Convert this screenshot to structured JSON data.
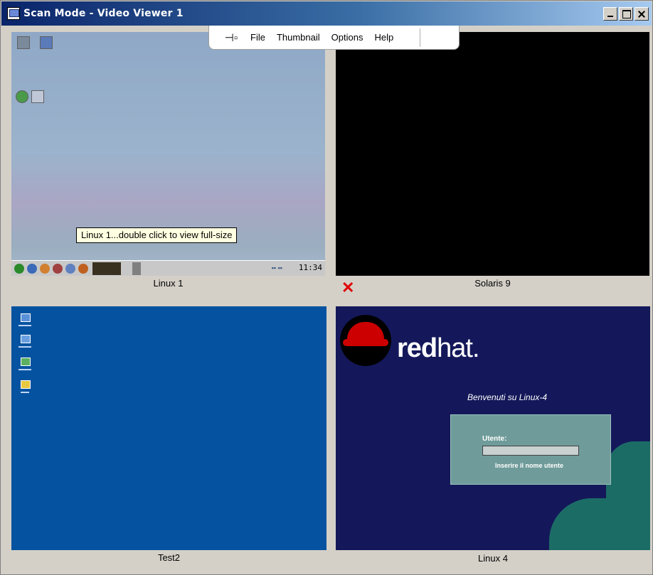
{
  "window": {
    "title": "Scan Mode - Video Viewer 1"
  },
  "menubar": {
    "pin_icon": "pin-icon",
    "items": [
      {
        "label": "File"
      },
      {
        "label": "Thumbnail"
      },
      {
        "label": "Options"
      },
      {
        "label": "Help"
      }
    ]
  },
  "thumbnails": [
    {
      "name": "Linux 1",
      "tooltip": "Linux 1...double click to view full-size",
      "clock": "11:34"
    },
    {
      "name": "Solaris 9",
      "status_icon": "red-x-icon"
    },
    {
      "name": "Test2"
    },
    {
      "name": "Linux 4",
      "brand_bold": "red",
      "brand_rest": "hat.",
      "welcome": "Benvenuti su Linux-4",
      "login_label": "Utente:",
      "login_hint": "Inserire il nome utente"
    }
  ],
  "colors": {
    "title_gradient_start": "#0a246a",
    "solaris_bg": "#000000",
    "test2_bg": "#0553a0",
    "linux4_bg": "#14185a",
    "status_error": "#e00000"
  }
}
